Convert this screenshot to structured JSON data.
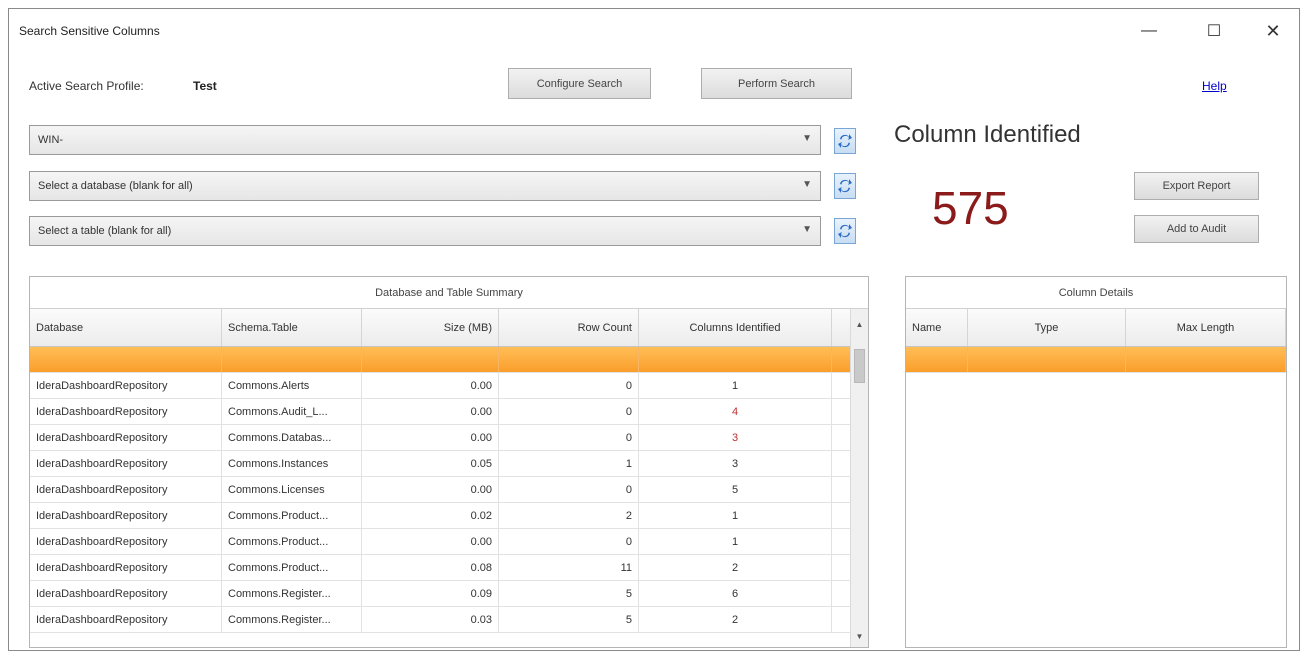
{
  "window": {
    "title": "Search Sensitive Columns",
    "min_glyph": "—",
    "max_glyph": "☐",
    "close_glyph": "✕"
  },
  "profile": {
    "label": "Active Search Profile:",
    "name": "Test"
  },
  "toolbar": {
    "configure_label": "Configure Search",
    "perform_label": "Perform Search",
    "help_label": "Help"
  },
  "selectors": {
    "server_value": "WIN-",
    "database_placeholder": "Select a database (blank for all)",
    "table_placeholder": "Select a table (blank for all)"
  },
  "result": {
    "label": "Column Identified",
    "count": "575",
    "export_label": "Export Report",
    "audit_label": "Add to Audit"
  },
  "summary": {
    "caption": "Database and Table Summary",
    "headers": [
      "Database",
      "Schema.Table",
      "Size (MB)",
      "Row Count",
      "Columns Identified"
    ],
    "rows": [
      {
        "database": "",
        "table": "",
        "size": "",
        "rows": "",
        "cols": "",
        "selected": true
      },
      {
        "database": "IderaDashboardRepository",
        "table": "Commons.Alerts",
        "size": "0.00",
        "rows": "0",
        "cols": "1"
      },
      {
        "database": "IderaDashboardRepository",
        "table": "Commons.Audit_L...",
        "size": "0.00",
        "rows": "0",
        "cols": "4"
      },
      {
        "database": "IderaDashboardRepository",
        "table": "Commons.Databas...",
        "size": "0.00",
        "rows": "0",
        "cols": "3"
      },
      {
        "database": "IderaDashboardRepository",
        "table": "Commons.Instances",
        "size": "0.05",
        "rows": "1",
        "cols": "3"
      },
      {
        "database": "IderaDashboardRepository",
        "table": "Commons.Licenses",
        "size": "0.00",
        "rows": "0",
        "cols": "5"
      },
      {
        "database": "IderaDashboardRepository",
        "table": "Commons.Product...",
        "size": "0.02",
        "rows": "2",
        "cols": "1"
      },
      {
        "database": "IderaDashboardRepository",
        "table": "Commons.Product...",
        "size": "0.00",
        "rows": "0",
        "cols": "1"
      },
      {
        "database": "IderaDashboardRepository",
        "table": "Commons.Product...",
        "size": "0.08",
        "rows": "11",
        "cols": "2"
      },
      {
        "database": "IderaDashboardRepository",
        "table": "Commons.Register...",
        "size": "0.09",
        "rows": "5",
        "cols": "6"
      },
      {
        "database": "IderaDashboardRepository",
        "table": "Commons.Register...",
        "size": "0.03",
        "rows": "5",
        "cols": "2"
      }
    ]
  },
  "details": {
    "caption": "Column Details",
    "headers": [
      "Name",
      "Type",
      "Max Length"
    ],
    "rows": [
      {
        "name": "",
        "type": "",
        "max": "",
        "selected": true
      }
    ]
  }
}
